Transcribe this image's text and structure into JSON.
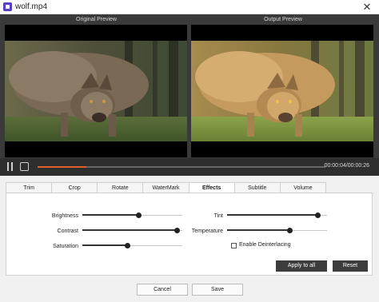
{
  "window": {
    "title": "wolf.mp4",
    "close_glyph": "✕",
    "icon": "app-video-icon"
  },
  "preview": {
    "original_label": "Original Preview",
    "output_label": "Output Preview",
    "image": "wolf walking toward camera in forest"
  },
  "player": {
    "pause_icon": "pause-icon",
    "stop_icon": "stop-icon",
    "progress_fraction": 0.17,
    "timecode": "00:00:04/00:00:26"
  },
  "tabs": [
    {
      "label": "Trim"
    },
    {
      "label": "Crop"
    },
    {
      "label": "Rotate"
    },
    {
      "label": "WaterMark"
    },
    {
      "label": "Effects",
      "active": true
    },
    {
      "label": "Subtitle"
    },
    {
      "label": "Volume"
    }
  ],
  "effects": {
    "brightness": {
      "label": "Brightness",
      "value": 0.56
    },
    "contrast": {
      "label": "Contrast",
      "value": 0.94
    },
    "saturation": {
      "label": "Saturation",
      "value": 0.45
    },
    "tint": {
      "label": "Tint",
      "value": 0.9
    },
    "temperature": {
      "label": "Temperature",
      "value": 0.62
    },
    "deinterlacing": {
      "label": "Enable Deinterlacing",
      "checked": false
    }
  },
  "buttons": {
    "apply_all": "Apply to all",
    "reset": "Reset",
    "cancel": "Cancel",
    "save": "Save"
  },
  "colors": {
    "accent": "#e2602a",
    "editor_bg": "#3a3a3a",
    "button_dark": "#3c3c3c"
  }
}
